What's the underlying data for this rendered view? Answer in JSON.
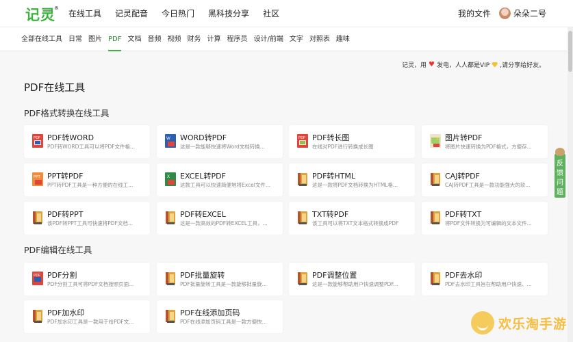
{
  "brand": {
    "logo": "记灵",
    "reg": "®"
  },
  "nav": [
    "在线工具",
    "记灵配音",
    "今日热门",
    "黑科技分享",
    "社区"
  ],
  "my_files": "我的文件",
  "user_name": "朵朵二号",
  "categories": [
    "全部在线工具",
    "日常",
    "图片",
    "PDF",
    "文档",
    "音频",
    "视频",
    "财务",
    "计算",
    "程序员",
    "设计/前端",
    "文字",
    "对照表",
    "趣味"
  ],
  "active_category": "PDF",
  "notice": {
    "before": "记灵，用",
    "mid": "发电，人人都是VIP",
    "after": ",请分享给好友。"
  },
  "page_title": "PDF在线工具",
  "sections": [
    {
      "title": "PDF格式转换在线工具",
      "tools": [
        {
          "name": "PDF转WORD",
          "desc": "PDF转WORD工具可以将PDF文件格...",
          "icon": "pdf-word"
        },
        {
          "name": "WORD转PDF",
          "desc": "这是一款能够快速将Word文档转换...",
          "icon": "word"
        },
        {
          "name": "PDF转长图",
          "desc": "在线对PDF进行转换成长图",
          "icon": "pdf-image"
        },
        {
          "name": "图片转PDF",
          "desc": "将图片快速转换为PDF格式，方便存...",
          "icon": "image"
        },
        {
          "name": "PPT转PDF",
          "desc": "PPT转PDF工具是一种方便的在线工...",
          "icon": "ppt"
        },
        {
          "name": "EXCEL转PDF",
          "desc": "这款工具可以快速简便地将Excel文件...",
          "icon": "excel"
        },
        {
          "name": "PDF转HTML",
          "desc": "这是一款将PDF文档转换为HTML格...",
          "icon": "book"
        },
        {
          "name": "CAJ转PDF",
          "desc": "CAJ转PDF工具是一款功能强大的软...",
          "icon": "book"
        },
        {
          "name": "PDF转PPT",
          "desc": "该PDF转PPT工具可快速将PDF文档...",
          "icon": "book"
        },
        {
          "name": "PDF转EXCEL",
          "desc": "这是一款高效的PDF转EXCEL工具，...",
          "icon": "book"
        },
        {
          "name": "TXT转PDF",
          "desc": "该工具可以将TXT文本格式转换成PDF",
          "icon": "book"
        },
        {
          "name": "PDF转TXT",
          "desc": "将PDF文件转换为可编辑的文本文件...",
          "icon": "book"
        }
      ]
    },
    {
      "title": "PDF编辑在线工具",
      "tools": [
        {
          "name": "PDF分割",
          "desc": "PDF分割工具可将PDF文档按照页面...",
          "icon": "split"
        },
        {
          "name": "PDF批量旋转",
          "desc": "PDF批量旋转工具是一款能够批量旋...",
          "icon": "book"
        },
        {
          "name": "PDF调整位置",
          "desc": "这是一款能够帮助用户快速调整PDF...",
          "icon": "book"
        },
        {
          "name": "PDF去水印",
          "desc": "PDF去水印工具旨在帮助用户快速、...",
          "icon": "book"
        },
        {
          "name": "PDF加水印",
          "desc": "PDF加水印工具是一款用于给PDF文...",
          "icon": "book"
        },
        {
          "name": "PDF在线添加页码",
          "desc": "PDF在线添加页码工具是一款方便快...",
          "icon": "book"
        }
      ]
    }
  ],
  "feedback": [
    "反",
    "馈",
    "问",
    "题"
  ],
  "watermark": "欢乐淘手游",
  "colors": {
    "accent": "#3db43d",
    "pdf_red": "#e0453a",
    "word_blue": "#2b5fb4",
    "excel_green": "#2e8b46",
    "book_orange": "#e2a23a"
  }
}
